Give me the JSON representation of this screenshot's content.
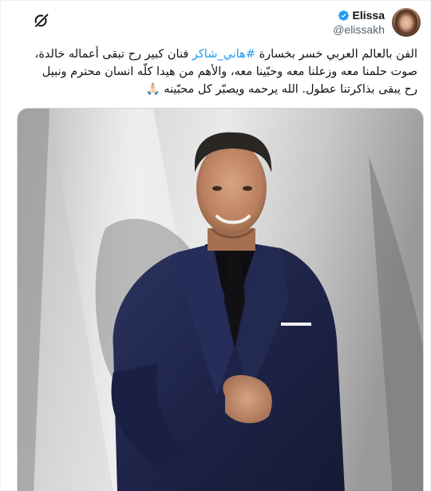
{
  "user": {
    "display_name": "Elissa",
    "handle": "@elissakh"
  },
  "tweet": {
    "line1_a": "الفن بالعالم العربي خسر بخسارة ",
    "line1_hashtag": "#هاني_شاكر",
    "line1_b": " فنان كبير رح تبقى أعماله خالدة،",
    "line2": "صوت حلمنا معه وزعلنا معه وحبّينا معه، والأهم من هيدا كلّه انسان محترم ونبيل",
    "line3": "رح يبقى بذاكرتنا عطول. الله يرحمه ويصبّر كل محبّينه 🙏🏻"
  },
  "icons": {
    "verified": "verified-badge-icon",
    "grok": "grok-icon"
  },
  "colors": {
    "accent": "#1d9bf0",
    "text": "#0f1419",
    "muted": "#536471"
  }
}
